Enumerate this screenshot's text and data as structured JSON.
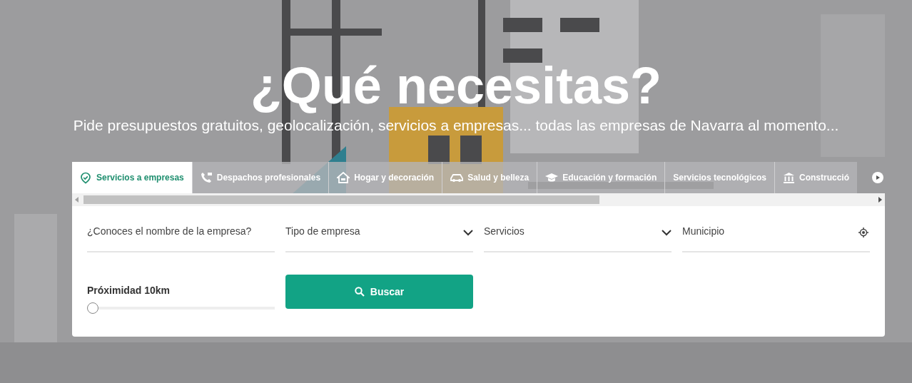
{
  "hero": {
    "title": "¿Qué necesitas?",
    "subtitle": "Pide presupuestos gratuitos, geolocalización, servicios a empresas... todas las empresas de Navarra al momento..."
  },
  "tabs": [
    {
      "label": "Servicios a empresas",
      "selected": true
    },
    {
      "label": "Despachos profesionales",
      "selected": false
    },
    {
      "label": "Hogar y decoración",
      "selected": false
    },
    {
      "label": "Salud y belleza",
      "selected": false
    },
    {
      "label": "Educación y formación",
      "selected": false
    },
    {
      "label": "Servicios tecnológicos",
      "selected": false
    },
    {
      "label": "Construcció",
      "selected": false
    }
  ],
  "search": {
    "fields": [
      {
        "kind": "text",
        "placeholder": "¿Conoces el nombre de la empresa?"
      },
      {
        "kind": "select",
        "placeholder": "Tipo de empresa"
      },
      {
        "kind": "select",
        "placeholder": "Servicios"
      },
      {
        "kind": "location",
        "placeholder": "Municipio"
      }
    ],
    "proximity": {
      "label": "Próximidad 10km",
      "level": 0
    },
    "button": "Buscar"
  }
}
